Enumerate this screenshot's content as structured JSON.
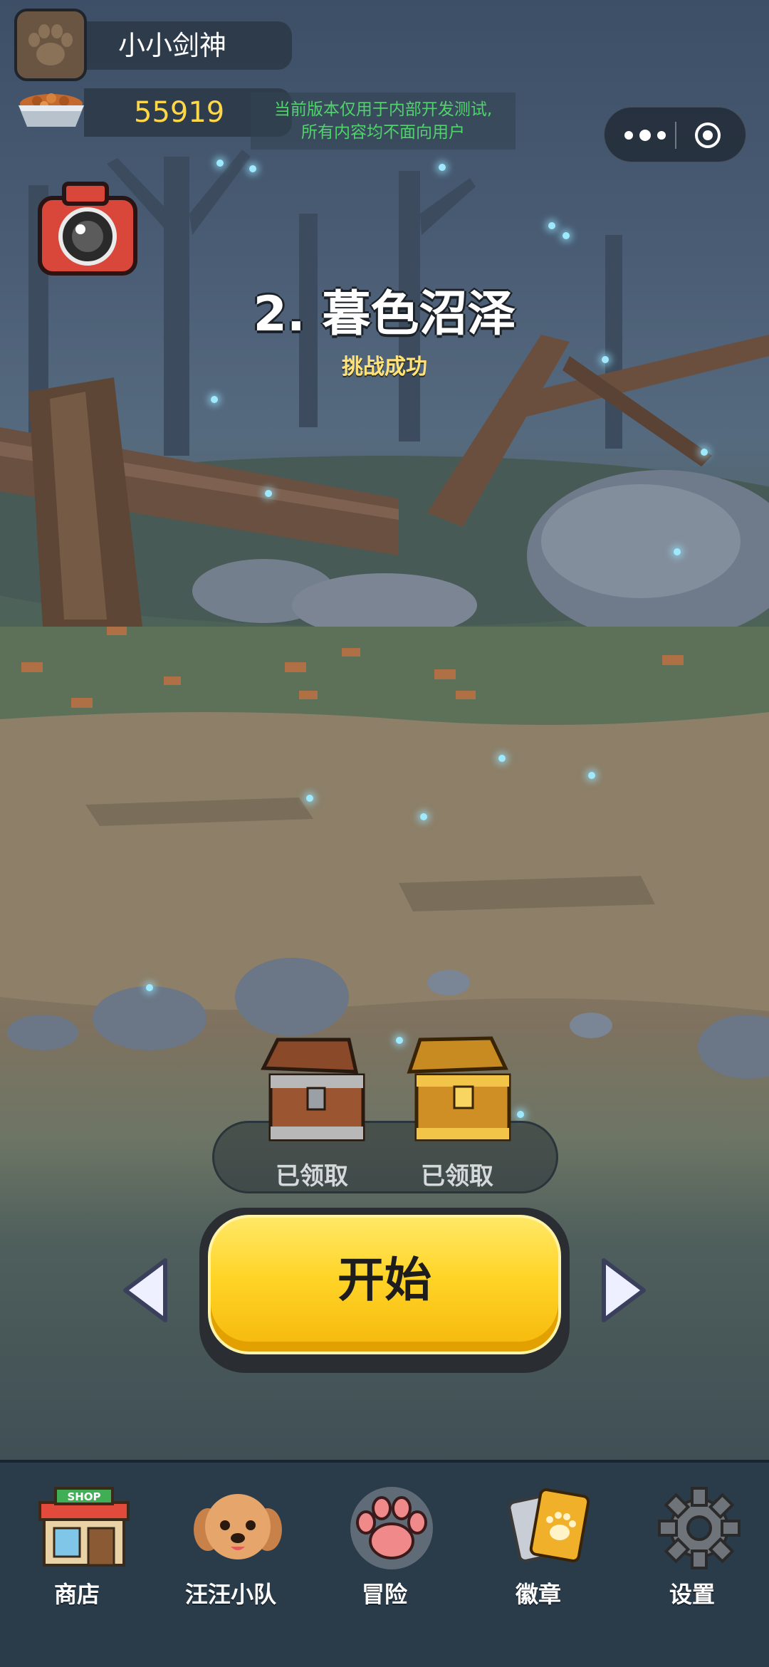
{
  "profile": {
    "player_name": "小小剑神",
    "food_count": "55919",
    "avatar_icon": "paw-icon",
    "currency_icon": "food-bowl-icon"
  },
  "notice": {
    "line1": "当前版本仅用于内部开发测试,",
    "line2": "所有内容均不面向用户"
  },
  "level": {
    "title": "2. 暮色沼泽",
    "status": "挑战成功"
  },
  "rewards": [
    {
      "icon": "wooden-chest-icon",
      "label": "已领取"
    },
    {
      "icon": "golden-chest-icon",
      "label": "已领取"
    }
  ],
  "start_button": {
    "label": "开始"
  },
  "nav": [
    {
      "label": "商店",
      "icon": "shop-icon",
      "sign": "SHOP"
    },
    {
      "label": "汪汪小队",
      "icon": "dog-icon"
    },
    {
      "label": "冒险",
      "icon": "paw-icon",
      "active": true
    },
    {
      "label": "徽章",
      "icon": "badge-icon"
    },
    {
      "label": "设置",
      "icon": "gear-icon"
    }
  ],
  "colors": {
    "accent_yellow": "#ffd427",
    "notice_green": "#4fd36a",
    "gold_text": "#ffd84a"
  }
}
